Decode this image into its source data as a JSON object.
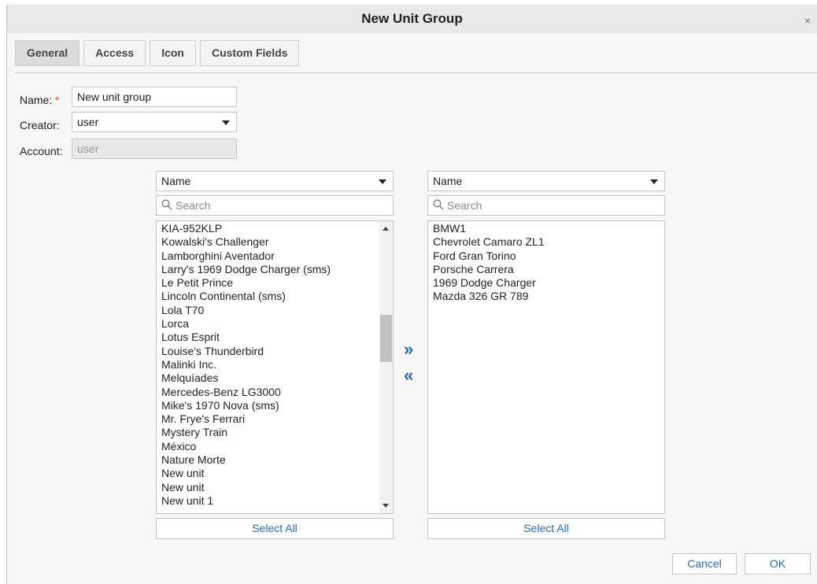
{
  "dialog": {
    "title": "New Unit Group",
    "close_glyph": "×"
  },
  "tabs": [
    {
      "label": "General",
      "active": true
    },
    {
      "label": "Access",
      "active": false
    },
    {
      "label": "Icon",
      "active": false
    },
    {
      "label": "Custom Fields",
      "active": false
    }
  ],
  "form": {
    "name_label": "Name:",
    "required_mark": "*",
    "name_value": "New unit group",
    "creator_label": "Creator:",
    "creator_value": "user",
    "account_label": "Account:",
    "account_value": "user"
  },
  "left_panel": {
    "sort_value": "Name",
    "search_placeholder": "Search",
    "items": [
      "KIA-952KLP",
      "Kowalski's Challenger",
      "Lamborghini Aventador",
      "Larry's 1969 Dodge Charger (sms)",
      "Le Petit Prince",
      "Lincoln Continental (sms)",
      "Lola T70",
      "Lorca",
      "Lotus Esprit",
      "Louise's Thunderbird",
      "Malinki Inc.",
      "Melquíades",
      "Mercedes-Benz LG3000",
      "Mike's 1970 Nova (sms)",
      "Mr. Frye's Ferrari",
      "Mystery Train",
      "México",
      "Nature Morte",
      "New unit",
      "New unit",
      "New unit 1"
    ],
    "select_all_label": "Select All"
  },
  "right_panel": {
    "sort_value": "Name",
    "search_placeholder": "Search",
    "items": [
      "BMW1",
      "Chevrolet Camaro ZL1",
      "Ford Gran Torino",
      "Porsche Carrera",
      "1969 Dodge Charger",
      "Mazda 326 GR 789"
    ],
    "select_all_label": "Select All"
  },
  "move": {
    "add_glyph": "»",
    "remove_glyph": "«"
  },
  "footer": {
    "cancel_label": "Cancel",
    "ok_label": "OK"
  },
  "colors": {
    "accent": "#2a69a8",
    "required": "#e14b4b"
  }
}
